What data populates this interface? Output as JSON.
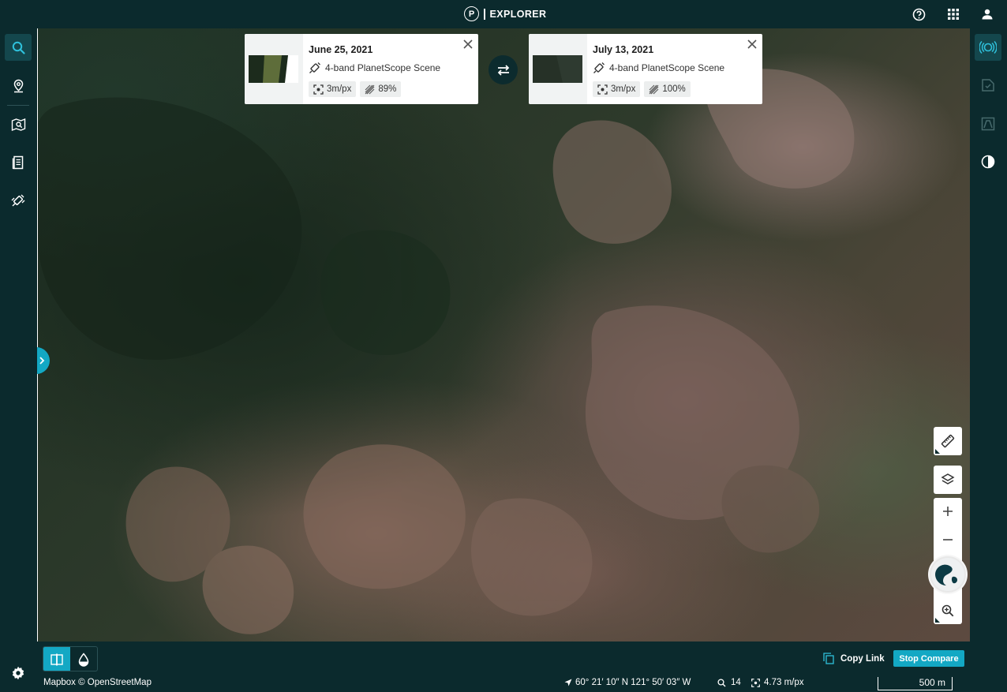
{
  "app": {
    "logo_letter": "P",
    "title": "EXPLORER"
  },
  "colors": {
    "bar": "#0b2a2d",
    "accent": "#13a8c4",
    "card_bg": "#ffffff"
  },
  "topbar": {
    "icons": [
      "help-icon",
      "apps-grid-icon",
      "account-icon"
    ]
  },
  "leftbar": {
    "icons": [
      "search-icon",
      "places-icon",
      "monitoring-icon",
      "orders-icon",
      "tasking-icon",
      "settings-icon"
    ],
    "active": "search-icon"
  },
  "rightbar": {
    "icons": [
      "compare-icon",
      "analysis-icon",
      "elevation-icon",
      "time-lapse-icon"
    ],
    "active": "compare-icon"
  },
  "compare": {
    "left": {
      "date": "June 25, 2021",
      "type": "4-band PlanetScope Scene",
      "resolution": "3m/px",
      "clear": "89%"
    },
    "right": {
      "date": "July 13, 2021",
      "type": "4-band PlanetScope Scene",
      "resolution": "3m/px",
      "clear": "100%"
    }
  },
  "map_tools": [
    "measure-icon",
    "layers-icon",
    "zoom-in-icon",
    "zoom-out-icon",
    "globe-icon",
    "zoom-to-icon"
  ],
  "bottom": {
    "copy_link": "Copy Link",
    "stop_compare": "Stop Compare",
    "view_modes": [
      "split-view-icon",
      "opacity-icon"
    ],
    "active_mode": "split-view-icon"
  },
  "status": {
    "attribution": "Mapbox © OpenStreetMap",
    "coordinates": "60° 21′ 10″ N 121° 50′ 03″ W",
    "zoom": "14",
    "resolution": "4.73 m/px",
    "scale": "500 m"
  }
}
